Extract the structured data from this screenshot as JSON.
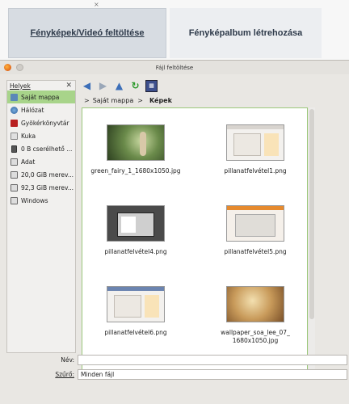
{
  "webpage": {
    "tab_upload": "Fényképek/Videó feltöltése",
    "tab_album": "Fényképalbum létrehozása",
    "close_glyph": "×"
  },
  "dialog": {
    "title": "Fájl feltöltése",
    "sidebar": {
      "header": "Helyek",
      "close_glyph": "✕",
      "items": [
        {
          "label": "Saját mappa",
          "icon": "home-folder-icon"
        },
        {
          "label": "Hálózat",
          "icon": "network-icon"
        },
        {
          "label": "Gyökérkönyvtár",
          "icon": "root-folder-icon"
        },
        {
          "label": "Kuka",
          "icon": "trash-icon"
        },
        {
          "label": "0 B cserélhető ...",
          "icon": "usb-drive-icon"
        },
        {
          "label": "Adat",
          "icon": "drive-icon"
        },
        {
          "label": "20,0 GiB merev...",
          "icon": "drive-icon"
        },
        {
          "label": "92,3 GiB merev...",
          "icon": "drive-icon"
        },
        {
          "label": "Windows",
          "icon": "drive-icon"
        }
      ]
    },
    "toolbar": {
      "back_icon": "◀",
      "forward_icon": "▶",
      "up_icon": "▲",
      "reload_icon": "↻",
      "view_icon": "▦"
    },
    "breadcrumb": {
      "sep": ">",
      "parent": "Saját mappa",
      "current": "Képek"
    },
    "files": [
      {
        "name": "green_fairy_1_1680x1050.jpg"
      },
      {
        "name": "pillanatfelvétel1.png"
      },
      {
        "name": "pillanatfelvétel4.png"
      },
      {
        "name": "pillanatfelvétel5.png"
      },
      {
        "name": "pillanatfelvétel6.png"
      },
      {
        "name": "wallpaper_soa_lee_07_\n1680x1050.jpg"
      }
    ],
    "name_label": "Név:",
    "name_value": "",
    "filter_label": "Szűrő:",
    "filter_value": "Minden fájl"
  },
  "colors": {
    "selected_place": "#a8d48a",
    "files_border": "#9bc87a"
  }
}
